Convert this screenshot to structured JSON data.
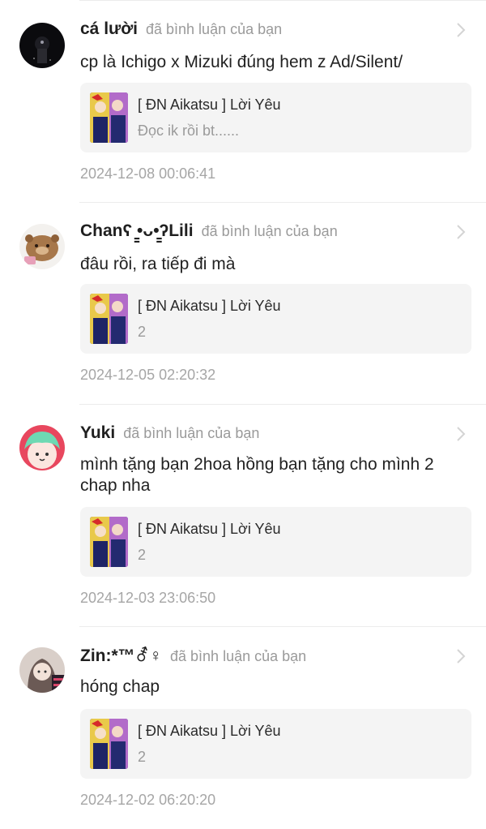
{
  "notifications": [
    {
      "username": "cá lười",
      "action": "đã bình luận của bạn",
      "comment": "cp là Ichigo x Mizuki đúng hem z Ad/Silent/",
      "story_title": "[ ĐN Aikatsu ] Lời Yêu",
      "story_snippet": "Đọc ik rồi bt......",
      "timestamp": "2024-12-08 00:06:41"
    },
    {
      "username": "Chanʕ ̳•ᴗ•̳ʔLili",
      "action": "đã bình luận của bạn",
      "comment": "đâu rồi, ra tiếp đi mà",
      "story_title": "[ ĐN Aikatsu ] Lời Yêu",
      "story_snippet": "2",
      "timestamp": "2024-12-05 02:20:32"
    },
    {
      "username": "Yuki",
      "action": "đã bình luận của bạn",
      "comment": "mình tặng bạn 2hoa hồng bạn tặng cho mình 2 chap nha",
      "story_title": "[ ĐN Aikatsu ] Lời Yêu",
      "story_snippet": "2",
      "timestamp": "2024-12-03 23:06:50"
    },
    {
      "username": "Zin:*™⚦♀",
      "action": "đã bình luận của bạn",
      "comment": "hóng chap",
      "story_title": "[ ĐN Aikatsu ] Lời Yêu",
      "story_snippet": "2",
      "timestamp": "2024-12-02 06:20:20"
    }
  ],
  "icons": {
    "chevron": "chevron-right-icon",
    "cover": "book-cover-thumbnail"
  },
  "colors": {
    "card_bg": "#f4f4f4",
    "muted_text": "#9a9a9a",
    "timestamp": "#a6a6a6"
  }
}
